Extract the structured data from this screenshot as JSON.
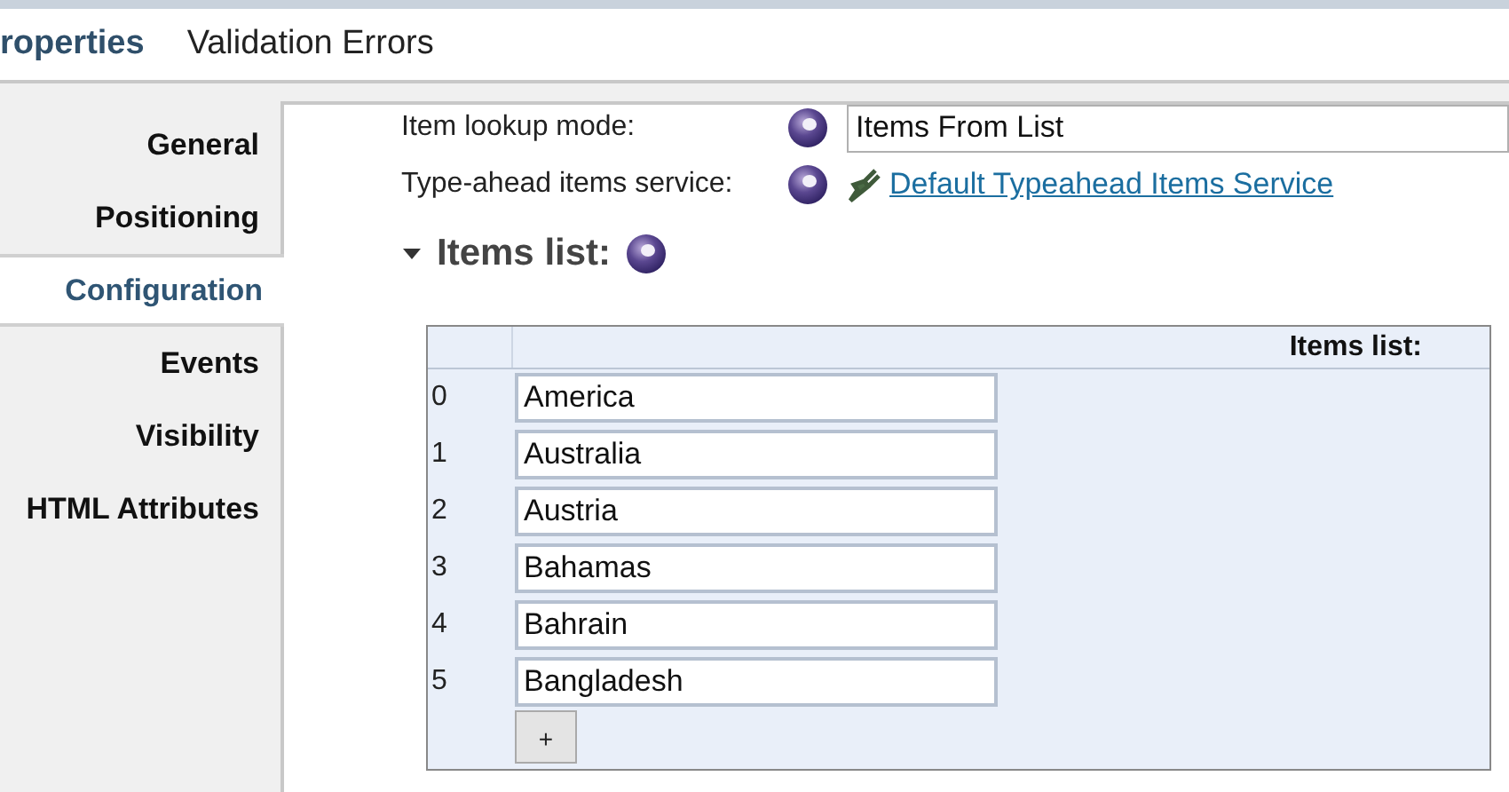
{
  "tabs": [
    {
      "label": "roperties",
      "selected": true
    },
    {
      "label": "Validation Errors",
      "selected": false
    }
  ],
  "sidebar": {
    "items": [
      {
        "label": "General",
        "selected": false
      },
      {
        "label": "Positioning",
        "selected": false
      },
      {
        "label": "Configuration",
        "selected": true
      },
      {
        "label": "Events",
        "selected": false
      },
      {
        "label": "Visibility",
        "selected": false
      },
      {
        "label": "HTML Attributes",
        "selected": false
      }
    ]
  },
  "config": {
    "item_lookup_mode": {
      "label": "Item lookup mode:",
      "value": "Items From List"
    },
    "typeahead_service": {
      "label": "Type-ahead items service:",
      "link": "Default Typeahead Items Service"
    },
    "items_section": {
      "title": "Items list:",
      "expanded": true,
      "table": {
        "column_header": "Items list:",
        "rows": [
          {
            "index": "0",
            "value": "America"
          },
          {
            "index": "1",
            "value": "Australia"
          },
          {
            "index": "2",
            "value": "Austria"
          },
          {
            "index": "3",
            "value": "Bahamas"
          },
          {
            "index": "4",
            "value": "Bahrain"
          },
          {
            "index": "5",
            "value": "Bangladesh"
          }
        ],
        "add_button": "+"
      }
    }
  }
}
